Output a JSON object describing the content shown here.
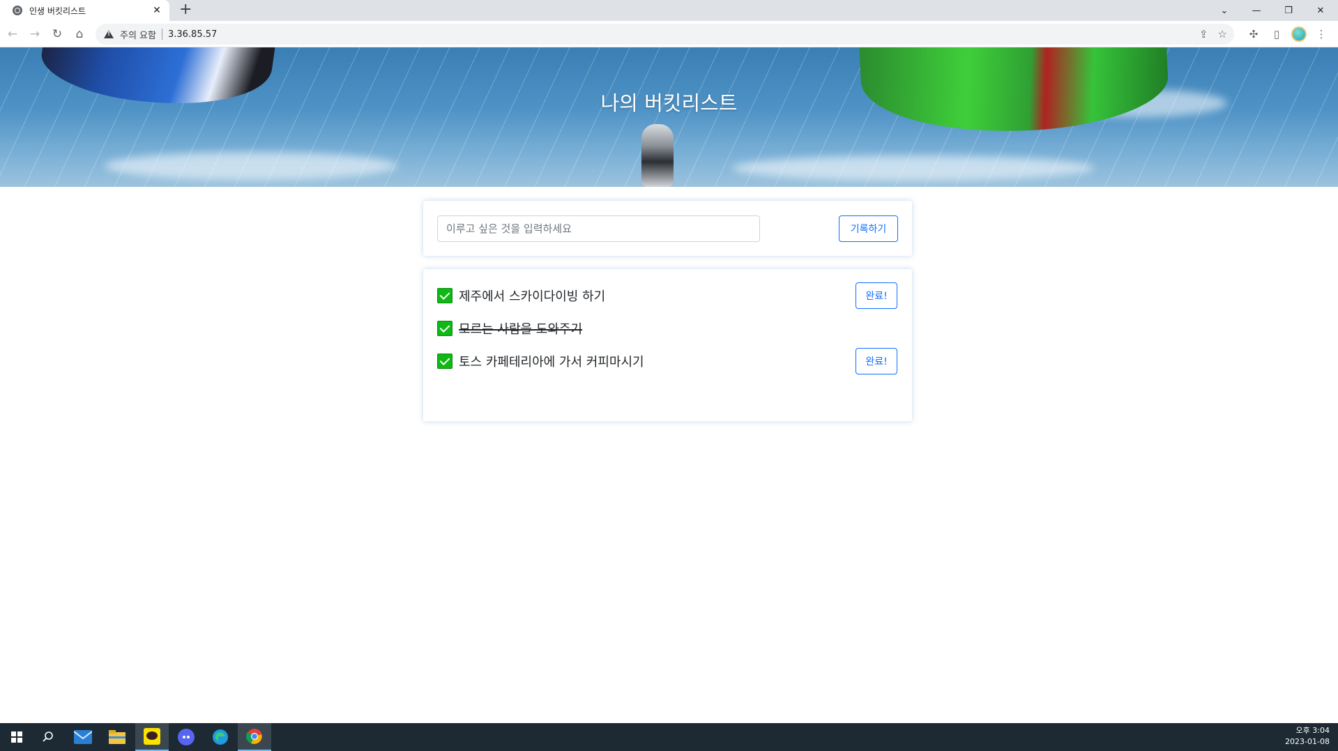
{
  "browser": {
    "tab_title": "인생 버킷리스트",
    "security_label": "주의 요함",
    "url": "3.36.85.57"
  },
  "page": {
    "title": "나의 버킷리스트",
    "input_placeholder": "이루고 싶은 것을 입력하세요",
    "save_label": "기록하기",
    "items": [
      {
        "text": "제주에서 스카이다이빙 하기",
        "done": false,
        "button": "완료!"
      },
      {
        "text": "모르는 사람을 도와주기",
        "done": true,
        "button": ""
      },
      {
        "text": "토스 카페테리아에 가서 커피마시기",
        "done": false,
        "button": "완료!"
      }
    ]
  },
  "taskbar": {
    "time": "오후 3:04",
    "date": "2023-01-08",
    "apps": [
      "windows-start",
      "search",
      "mail",
      "file-explorer",
      "kakaotalk",
      "discord",
      "edge",
      "chrome"
    ]
  }
}
